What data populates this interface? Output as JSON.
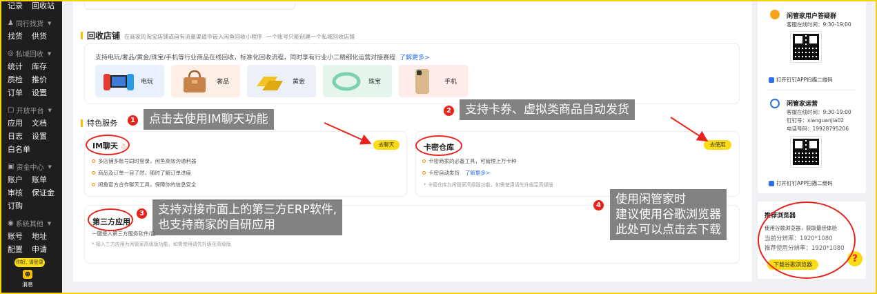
{
  "sidebar": {
    "top_row": [
      "记录",
      "回收站"
    ],
    "sections": [
      {
        "header": "同行找货",
        "icon": "people-icon",
        "rows": [
          [
            "找货",
            "供货"
          ]
        ]
      },
      {
        "header": "私域回收",
        "icon": "recycle-icon",
        "rows": [
          [
            "统计",
            "库存"
          ],
          [
            "质检",
            "推价"
          ],
          [
            "订单",
            "设置"
          ]
        ]
      },
      {
        "header": "开放平台",
        "icon": "platform-icon",
        "rows": [
          [
            "应用",
            "文档"
          ],
          [
            "日志",
            "设置"
          ],
          [
            "白名单"
          ]
        ]
      },
      {
        "header": "资金中心",
        "icon": "wallet-icon",
        "rows": [
          [
            "账户",
            "账单"
          ],
          [
            "审核",
            "保证金"
          ],
          [
            "订购"
          ]
        ]
      },
      {
        "header": "系统其他",
        "icon": "settings-icon",
        "rows": [
          [
            "账号",
            "地址"
          ],
          [
            "配置",
            "申请"
          ]
        ]
      }
    ],
    "login_badge": "你好, 请登录",
    "message_label": "消息"
  },
  "recycle": {
    "title": "回收店铺",
    "subtitle": "在商家的淘宝店铺或自有流量渠道中嵌入闲鱼回收小程序",
    "note": "一个账号只能创建一个私域回收店铺",
    "desc": "支持电玩/奢品/黄金/珠宝/手机等行业商品在线回收，标准化回收流程，同时享有行业小二精细化运营对接赛程",
    "learn_more": "了解更多>",
    "categories": [
      {
        "label": "电玩",
        "icon": "game-console-icon",
        "color": "#e8f1fd"
      },
      {
        "label": "奢品",
        "icon": "handbag-icon",
        "color": "#fdeee6"
      },
      {
        "label": "黄金",
        "icon": "gold-bar-icon",
        "color": "#eef0f9"
      },
      {
        "label": "珠宝",
        "icon": "bracelet-icon",
        "color": "#e6f5ec"
      },
      {
        "label": "手机",
        "icon": "phone-icon",
        "color": "#fdecea"
      }
    ]
  },
  "features": {
    "title": "特色服务",
    "im": {
      "title": "IM聊天",
      "button": "去聊天",
      "lines": [
        "多店铺多账号同时登录，闲鱼高效沟通利器",
        "商品及订单一目了然，随时了解订单进度",
        "闲鱼官方合作聊天工具，保障你的信息安全"
      ]
    },
    "card": {
      "title": "卡密仓库",
      "button": "去使用",
      "lines": [
        "卡密商家的必备工具，可管理上万卡种",
        "卡密自动发货"
      ],
      "learn_more": "了解更多>",
      "note": "* 卡密仓库为闲管家高级版功能，如需使用请先升级至高级版"
    },
    "third": {
      "title": "第三方应用",
      "line": "一键接入第三方服务软件/自",
      "note": "* 接入三方应用为闲管家高级版功能，如需使用请先升级至高级版"
    }
  },
  "callouts": {
    "c1": {
      "num": "1",
      "text": "点击去使用IM聊天功能"
    },
    "c2": {
      "num": "2",
      "text": "支持卡券、虚拟类商品自动发货"
    },
    "c3": {
      "num": "3",
      "line1": "支持对接市面上的第三方ERP软件,",
      "line2": "也支持商家的自研应用"
    },
    "c4": {
      "num": "4",
      "line1": "使用闲管家时",
      "line2": "建议使用谷歌浏览器",
      "line3": "此处可以点击去下载"
    }
  },
  "right_panel": {
    "group1": {
      "title": "闲管家用户答疑群",
      "hours": "客服在线时间：9:30-19:00",
      "link": "打开钉钉APP扫描二维码"
    },
    "group2": {
      "title": "闲管家运营",
      "hours": "客服在线时间：9:30-19:00",
      "dingtalk": "钉钉号：xianguanjia02",
      "phone": "电话号码：19928795206",
      "link": "打开钉钉APP扫描二维码"
    },
    "browser": {
      "title": "推荐浏览器",
      "line1": "使用谷歌浏览器，获取最佳体验",
      "line2": "当前分辨率：1920*1080",
      "line3": "推荐使用分辨率：1920*1080",
      "button": "下载谷歌浏览器"
    },
    "help": "?"
  }
}
